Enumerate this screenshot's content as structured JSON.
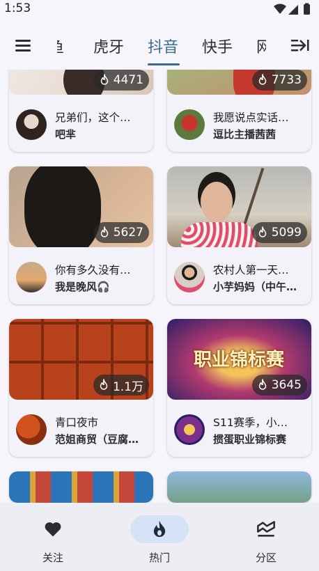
{
  "status_bar": {
    "time": "1:53",
    "icons": [
      "wifi-icon",
      "signal-icon",
      "battery-icon"
    ]
  },
  "top_bar": {
    "menu_icon": "menu-icon",
    "tabs": [
      {
        "label": "鱼",
        "active": false
      },
      {
        "label": "虎牙",
        "active": false
      },
      {
        "label": "抖音",
        "active": true
      },
      {
        "label": "快手",
        "active": false
      },
      {
        "label": "网",
        "active": false
      }
    ],
    "expand_icon": "expand-right-icon"
  },
  "colors": {
    "accent": "#3b6a92",
    "nav_active_pill": "#d6e3f7",
    "card_bg": "#f3f2f9",
    "page_bg": "#f6f5fb"
  },
  "cards": [
    {
      "heat": "4471",
      "title": "兄弟们，这个…",
      "streamer": "吧芈"
    },
    {
      "heat": "7733",
      "title": "我愿说点实话…",
      "streamer": "逗比主播茜茜"
    },
    {
      "heat": "5627",
      "title": "你有多久没有…",
      "streamer": "我是晚风🎧"
    },
    {
      "heat": "5099",
      "title": "农村人第一天…",
      "streamer": "小芋妈妈（中午…"
    },
    {
      "heat": "1.1万",
      "title": "青口夜市",
      "streamer": "范姐商贸（豆腐…"
    },
    {
      "heat": "3645",
      "title": "S11赛季，小…",
      "streamer": "掼蛋职业锦标赛",
      "thumb_text": "职业锦标赛"
    },
    {
      "heat": "",
      "title": "",
      "streamer": ""
    },
    {
      "heat": "",
      "title": "",
      "streamer": ""
    }
  ],
  "bottom_nav": [
    {
      "label": "关注",
      "icon": "heart-icon",
      "active": false
    },
    {
      "label": "热门",
      "icon": "flame-icon",
      "active": true
    },
    {
      "label": "分区",
      "icon": "category-icon",
      "active": false
    }
  ]
}
